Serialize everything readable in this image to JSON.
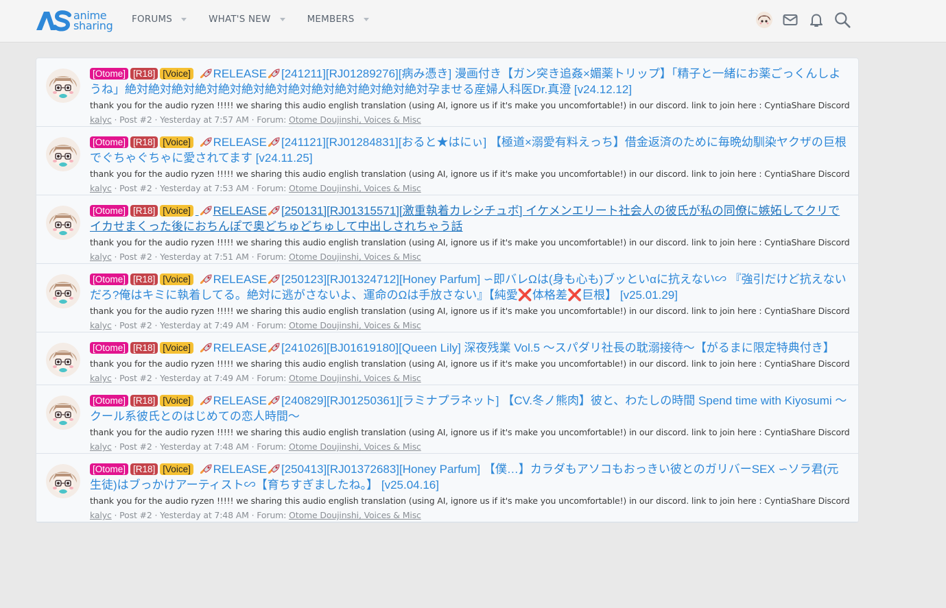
{
  "brand": {
    "mark": "AS",
    "line1": "anime",
    "line2": "sharing",
    "color": "#2e88d8"
  },
  "nav": [
    {
      "label": "FORUMS"
    },
    {
      "label": "WHAT'S NEW"
    },
    {
      "label": "MEMBERS"
    }
  ],
  "header_icons": [
    "user-avatar-icon",
    "envelope-icon",
    "bell-icon",
    "search-icon"
  ],
  "colors": {
    "tag_otome": "#e2148e",
    "tag_r18": "#c4434a",
    "tag_voice": "#f5c033",
    "link": "#2e88d8"
  },
  "results": [
    {
      "tags": [
        "[Otome]",
        "[R18]",
        "[Voice]"
      ],
      "release": "RELEASE",
      "title": "[241211][RJ01289276][病み憑き] 漫画付き【ガン突き追姦×媚薬トリップ】「精子と一緒にお薬ごっくんしようね」絶対絶対絶対絶対絶対絶対絶対絶対絶対絶対絶対絶対絶対孕ませる産婦人科医Dr.真澄 [v24.12.12]",
      "snippet": "thank you for the audio ryzen !!!!! we sharing this audio english translation (using AI, ignore us if it's make you uncomfortable!) in our discord. link to join here : CyntiaShare Discord",
      "author": "kalyc",
      "post": "Post #2",
      "time": "Yesterday at 7:57 AM",
      "forum_label": "Forum:",
      "forum": "Otome Doujinshi, Voices & Misc",
      "hovered": false
    },
    {
      "tags": [
        "[Otome]",
        "[R18]",
        "[Voice]"
      ],
      "release": "RELEASE",
      "title": "[241121][RJ01284831][おると★はにぃ] 【極道×溺愛有料えっち】借金返済のために毎晩幼馴染ヤクザの巨根でぐちゃぐちゃに愛されてます [v24.11.25]",
      "snippet": "thank you for the audio ryzen !!!!! we sharing this audio english translation (using AI, ignore us if it's make you uncomfortable!) in our discord. link to join here : CyntiaShare Discord",
      "author": "kalyc",
      "post": "Post #2",
      "time": "Yesterday at 7:53 AM",
      "forum_label": "Forum:",
      "forum": "Otome Doujinshi, Voices & Misc",
      "hovered": false
    },
    {
      "tags": [
        "[Otome]",
        "[R18]",
        "[Voice]"
      ],
      "release": "RELEASE",
      "title": "[250131][RJ01315571][激重執着カレシチュボ] イケメンエリート社会人の彼氏が私の同僚に嫉妬してクリでイカせまくった後におちんぽで奥どちゅどちゅして中出しされちゃう話",
      "snippet": "thank you for the audio ryzen !!!!! we sharing this audio english translation (using AI, ignore us if it's make you uncomfortable!) in our discord. link to join here : CyntiaShare Discord",
      "author": "kalyc",
      "post": "Post #2",
      "time": "Yesterday at 7:51 AM",
      "forum_label": "Forum:",
      "forum": "Otome Doujinshi, Voices & Misc",
      "hovered": true
    },
    {
      "tags": [
        "[Otome]",
        "[R18]",
        "[Voice]"
      ],
      "release": "RELEASE",
      "title": "[250123][RJ01324712][Honey Parfum] ∽即バレΩは(身も心も)ブッといαに抗えない∽ 『強引だけど抗えないだろ?俺はキミに執着してる。絶対に逃がさないよ、運命のΩは手放さない』【純愛❌体格差❌巨根】 [v25.01.29]",
      "snippet": "thank you for the audio ryzen !!!!! we sharing this audio english translation (using AI, ignore us if it's make you uncomfortable!) in our discord. link to join here : CyntiaShare Discord",
      "author": "kalyc",
      "post": "Post #2",
      "time": "Yesterday at 7:49 AM",
      "forum_label": "Forum:",
      "forum": "Otome Doujinshi, Voices & Misc",
      "hovered": false
    },
    {
      "tags": [
        "[Otome]",
        "[R18]",
        "[Voice]"
      ],
      "release": "RELEASE",
      "title": "[241026][BJ01619180][Queen Lily] 深夜残業 Vol.5 ～スパダリ社長の耽溺接待～【がるまに限定特典付き】",
      "snippet": "thank you for the audio ryzen !!!!! we sharing this audio english translation (using AI, ignore us if it's make you uncomfortable!) in our discord. link to join here : CyntiaShare Discord",
      "author": "kalyc",
      "post": "Post #2",
      "time": "Yesterday at 7:49 AM",
      "forum_label": "Forum:",
      "forum": "Otome Doujinshi, Voices & Misc",
      "hovered": false
    },
    {
      "tags": [
        "[Otome]",
        "[R18]",
        "[Voice]"
      ],
      "release": "RELEASE",
      "title": "[240829][RJ01250361][ラミナプラネット] 【CV.冬ノ熊肉】彼と、わたしの時間 Spend time with Kiyosumi ～クール系彼氏とのはじめての恋人時間～",
      "snippet": "thank you for the audio ryzen !!!!! we sharing this audio english translation (using AI, ignore us if it's make you uncomfortable!) in our discord. link to join here : CyntiaShare Discord",
      "author": "kalyc",
      "post": "Post #2",
      "time": "Yesterday at 7:48 AM",
      "forum_label": "Forum:",
      "forum": "Otome Doujinshi, Voices & Misc",
      "hovered": false
    },
    {
      "tags": [
        "[Otome]",
        "[R18]",
        "[Voice]"
      ],
      "release": "RELEASE",
      "title": "[250413][RJ01372683][Honey Parfum] 【僕…】カラダもアソコもおっきい彼とのガリバーSEX ∽ソラ君(元生徒)はブっかけアーティスト∽【育ちすぎましたね。】 [v25.04.16]",
      "snippet": "thank you for the audio ryzen !!!!! we sharing this audio english translation (using AI, ignore us if it's make you uncomfortable!) in our discord. link to join here : CyntiaShare Discord",
      "author": "kalyc",
      "post": "Post #2",
      "time": "Yesterday at 7:48 AM",
      "forum_label": "Forum:",
      "forum": "Otome Doujinshi, Voices & Misc",
      "hovered": false
    }
  ]
}
